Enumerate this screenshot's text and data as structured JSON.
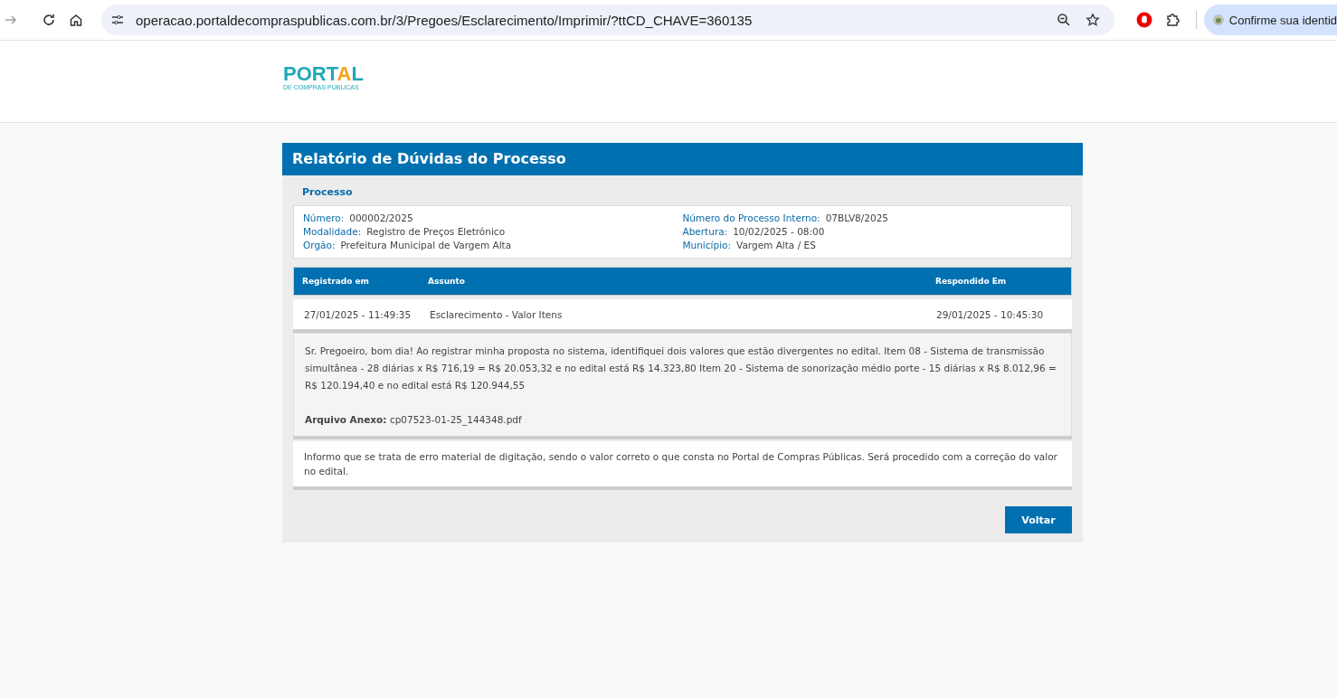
{
  "browser": {
    "url": "operacao.portaldecompraspublicas.com.br/3/Pregoes/Esclarecimento/Imprimir/?ttCD_CHAVE=360135",
    "profile_label": "Confirme sua identid"
  },
  "logo": {
    "parts": [
      "PORT",
      "A",
      "L"
    ],
    "subtitle": "DE COMPRAS PÚBLICAS"
  },
  "report": {
    "title": "Relatório de Dúvidas do Processo",
    "section": "Processo",
    "fields_left": [
      {
        "label": "Número:",
        "value": "000002/2025"
      },
      {
        "label": "Modalidade:",
        "value": "Registro de Preços Eletrônico"
      },
      {
        "label": "Orgão:",
        "value": "Prefeitura Municipal de Vargem Alta"
      }
    ],
    "fields_right": [
      {
        "label": "Número do Processo Interno:",
        "value": "07BLV8/2025"
      },
      {
        "label": "Abertura:",
        "value": "10/02/2025 - 08:00"
      },
      {
        "label": "Município:",
        "value": "Vargem Alta / ES"
      }
    ],
    "table": {
      "columns": [
        "Registrado em",
        "Assunto",
        "Respondido Em"
      ],
      "rows": [
        {
          "registered": "27/01/2025 - 11:49:35",
          "subject": "Esclarecimento - Valor Itens",
          "answered": "29/01/2025 - 10:45:30",
          "question": "Sr. Pregoeiro, bom dia! Ao registrar minha proposta no sistema, identifiquei dois valores que estão divergentes no edital. Item 08 - Sistema de transmissão simultânea - 28 diárias x R$ 716,19 = R$ 20.053,32 e no edital está R$ 14.323,80 Item 20 - Sistema de sonorização médio porte - 15 diárias x R$ 8.012,96 = R$ 120.194,40 e no edital está R$ 120.944,55",
          "attachment_label": "Arquivo Anexo:",
          "attachment": "cp07523-01-25_144348.pdf",
          "answer": "Informo que se trata de erro material de digitação, sendo o valor correto o que consta no Portal de Compras Públicas. Será procedido com a correção do valor no edital."
        }
      ]
    },
    "back_button": "Voltar"
  }
}
